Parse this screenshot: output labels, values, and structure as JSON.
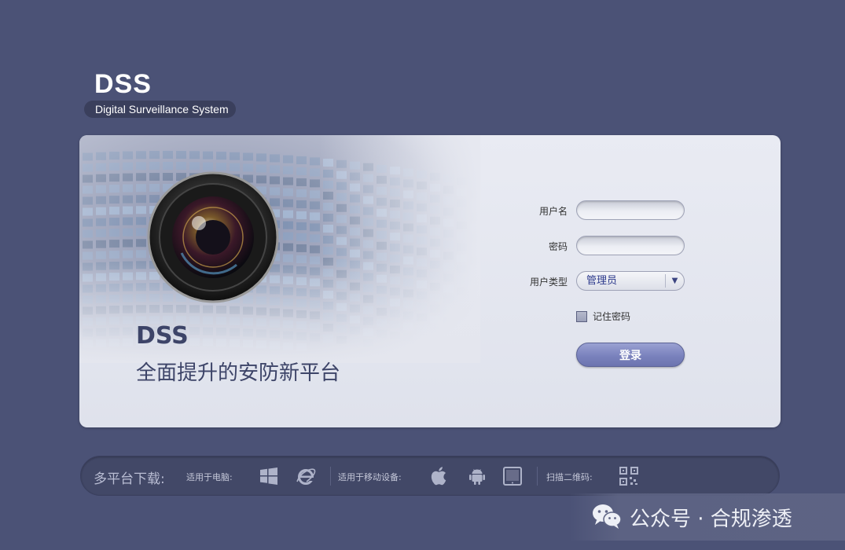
{
  "logo": {
    "title": "DSS",
    "subtitle": "Digital Surveillance System"
  },
  "hero": {
    "title": "DSS",
    "subtitle": "全面提升的安防新平台"
  },
  "login": {
    "username_label": "用户名",
    "username_value": "",
    "password_label": "密码",
    "password_value": "",
    "user_type_label": "用户类型",
    "user_type_value": "管理员",
    "remember_label": "记住密码",
    "login_button": "登录"
  },
  "download": {
    "title": "多平台下载:",
    "pc_label": "适用于电脑:",
    "mobile_label": "适用于移动设备:",
    "qr_label": "扫描二维码:",
    "icons": [
      "windows-icon",
      "ie-icon",
      "apple-icon",
      "android-icon",
      "tablet-icon",
      "qr-code-icon"
    ]
  },
  "watermark": {
    "text": "公众号 · 合规渗透"
  },
  "colors": {
    "background": "#4b5276",
    "accent": "#7a82bd",
    "text_dark": "#3d4468"
  }
}
